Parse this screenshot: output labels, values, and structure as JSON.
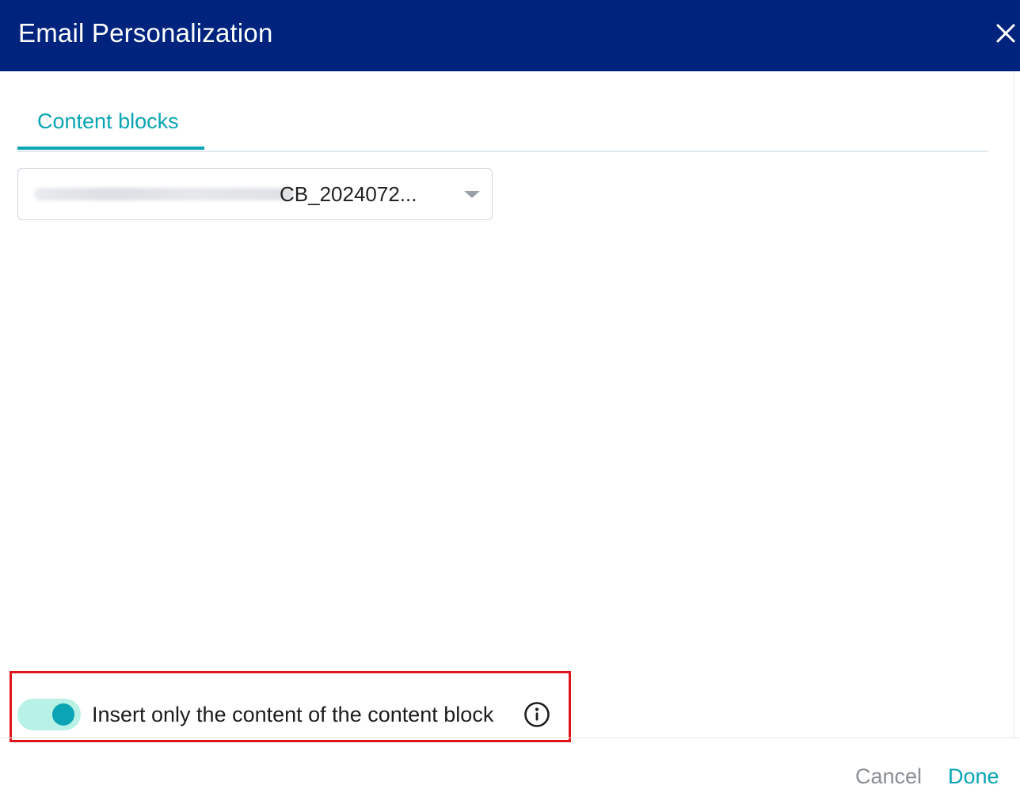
{
  "dialog": {
    "title": "Email Personalization",
    "close_icon": "close-icon"
  },
  "tabs": [
    {
      "label": "Content blocks",
      "active": true
    }
  ],
  "content_block_select": {
    "value": "CB_2024072...",
    "arrow_icon": "caret-down-icon"
  },
  "insert_toggle": {
    "label": "Insert only the content of the content block",
    "on": true,
    "info_icon": "info-icon"
  },
  "footer": {
    "cancel_label": "Cancel",
    "done_label": "Done"
  },
  "colors": {
    "header_bg": "#00247d",
    "accent": "#0aa4b4",
    "toggle_track": "#b8f1e6",
    "highlight": "#e0151b"
  }
}
